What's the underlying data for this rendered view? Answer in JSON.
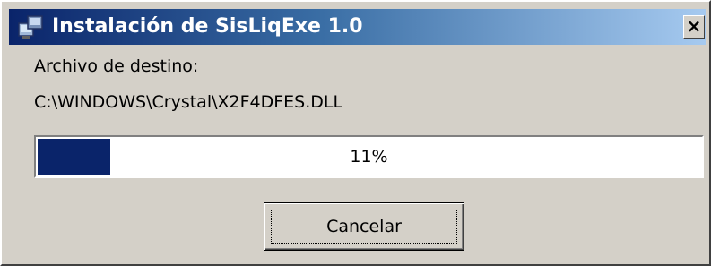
{
  "window": {
    "title": "Instalación de SisLiqExe 1.0",
    "app_icon": "installer-icon",
    "close_label": "×"
  },
  "dialog": {
    "destination_label": "Archivo de destino:",
    "destination_path": "C:\\WINDOWS\\Crystal\\X2F4DFES.DLL"
  },
  "progress": {
    "value": 0.11,
    "label": "11%",
    "fill_color": "#0a246a"
  },
  "buttons": {
    "cancel_label": "Cancelar"
  },
  "colors": {
    "titlebar_start": "#0a246a",
    "titlebar_end": "#a6caf0",
    "face": "#d4d0c8"
  }
}
